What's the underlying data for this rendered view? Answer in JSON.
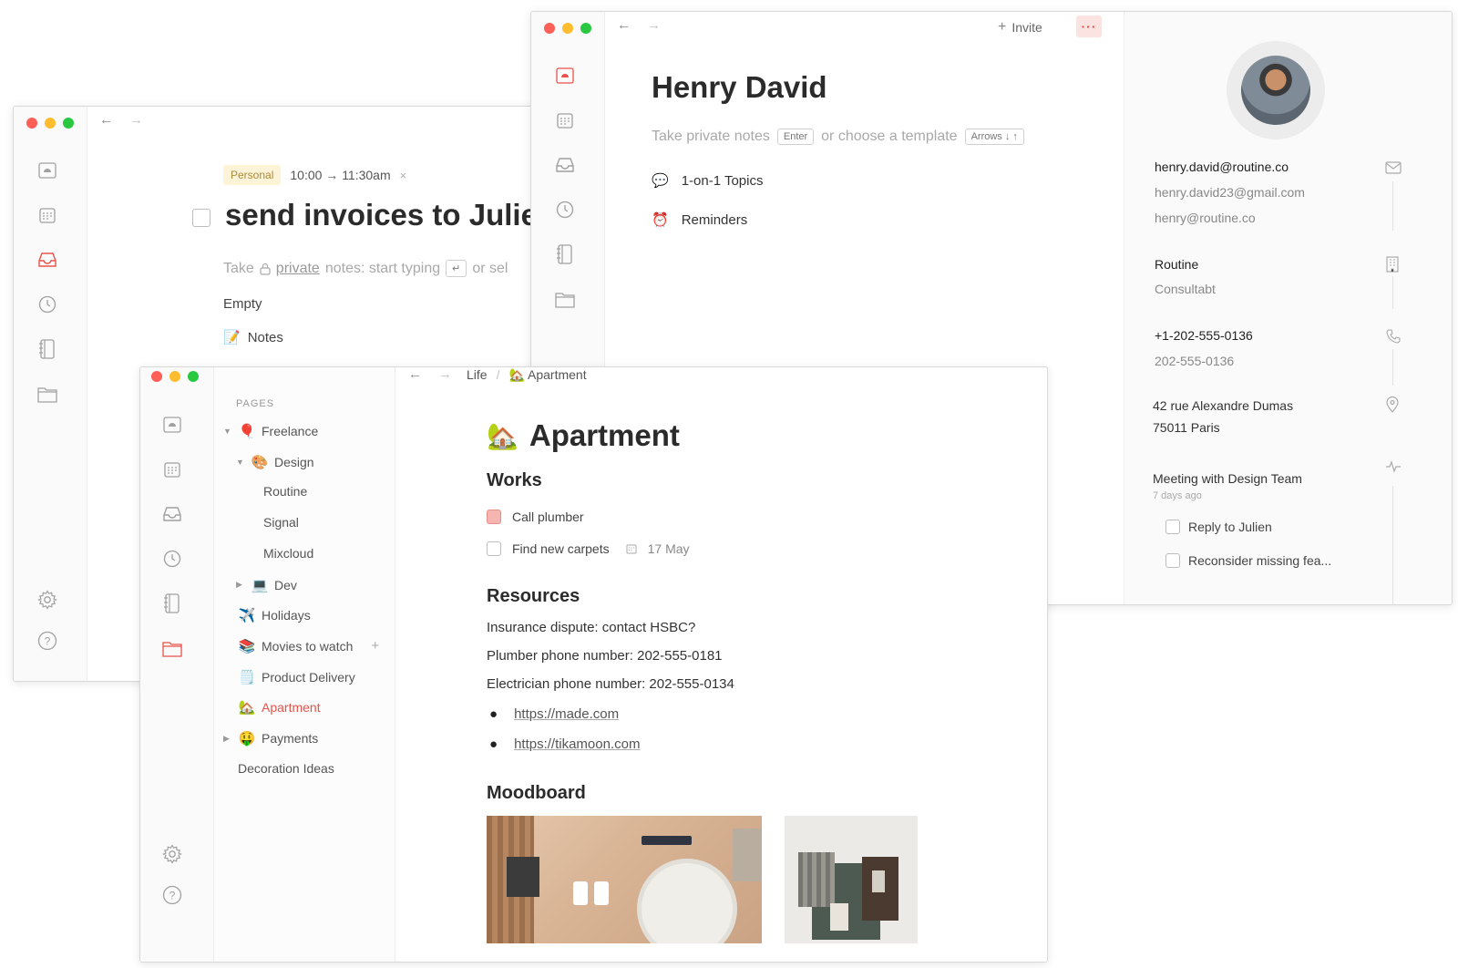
{
  "task_window": {
    "tag": "Personal",
    "time": "10:00 → 11:30am",
    "title": "send invoices to Julien",
    "notes_pre": "Take",
    "notes_private": "private",
    "notes_post": "notes: start typing",
    "notes_after_key": "or sel",
    "section_empty": "Empty",
    "section_notes": "Notes"
  },
  "contact_window": {
    "invite_label": "Invite",
    "name": "Henry David",
    "notes_hint": "Take private notes",
    "enter_key": "Enter",
    "template_hint": "or choose a template",
    "arrows_key": "Arrows ↓ ↑",
    "items": [
      {
        "icon": "speech-bubble-icon",
        "label": "1-on-1 Topics"
      },
      {
        "icon": "alarm-clock-icon",
        "label": "Reminders"
      }
    ],
    "emails": [
      "henry.david@routine.co",
      "henry.david23@gmail.com",
      "henry@routine.co"
    ],
    "company": "Routine",
    "role": "Consultabt",
    "phones": [
      "+1-202-555-0136",
      "202-555-0136"
    ],
    "address_line1": "42 rue Alexandre Dumas",
    "address_line2": "75011 Paris",
    "meeting_title": "Meeting with Design Team",
    "meeting_time": "7 days ago",
    "meeting_tasks": [
      "Reply to Julien",
      "Reconsider missing fea..."
    ]
  },
  "pages_window": {
    "breadcrumb_root": "Life",
    "breadcrumb_sep": "/",
    "breadcrumb_page": "🏡 Apartment",
    "sidebar_heading": "PAGES",
    "tree": [
      {
        "label": "Freelance",
        "emoji": "🎈",
        "toggle": "▼",
        "level": 0
      },
      {
        "label": "Design",
        "emoji": "🎨",
        "toggle": "▼",
        "level": 1
      },
      {
        "label": "Routine",
        "emoji": "",
        "toggle": "",
        "level": 2
      },
      {
        "label": "Signal",
        "emoji": "",
        "toggle": "",
        "level": 2
      },
      {
        "label": "Mixcloud",
        "emoji": "",
        "toggle": "",
        "level": 2
      },
      {
        "label": "Dev",
        "emoji": "💻",
        "toggle": "▶",
        "level": 1
      },
      {
        "label": "Holidays",
        "emoji": "✈️",
        "toggle": "",
        "level": 0
      },
      {
        "label": "Movies to watch",
        "emoji": "📚",
        "toggle": "",
        "level": 0,
        "add": "+"
      },
      {
        "label": "Product Delivery",
        "emoji": "🗒️",
        "toggle": "",
        "level": 0
      },
      {
        "label": "Apartment",
        "emoji": "🏡",
        "toggle": "",
        "level": 0,
        "active": true
      },
      {
        "label": "Payments",
        "emoji": "🤑",
        "toggle": "▶",
        "level": 0
      },
      {
        "label": "Decoration Ideas",
        "emoji": "",
        "toggle": "",
        "level": 0
      }
    ],
    "page_emoji": "🏡",
    "page_title": "Apartment",
    "works_heading": "Works",
    "works": [
      {
        "label": "Call plumber",
        "state": "flagged"
      },
      {
        "label": "Find new carpets",
        "state": "open",
        "date": "17 May"
      }
    ],
    "resources_heading": "Resources",
    "resources": [
      "Insurance dispute: contact HSBC?",
      "Plumber phone number: 202-555-0181",
      "Electrician phone number: 202-555-0134"
    ],
    "links": [
      "https://made.com",
      "https://tikamoon.com"
    ],
    "moodboard_heading": "Moodboard"
  },
  "colors": {
    "accent": "#e8524a",
    "tag_bg": "#fdf3d6",
    "tag_text": "#a98b3e",
    "flag_fill": "#f5b6b2"
  }
}
